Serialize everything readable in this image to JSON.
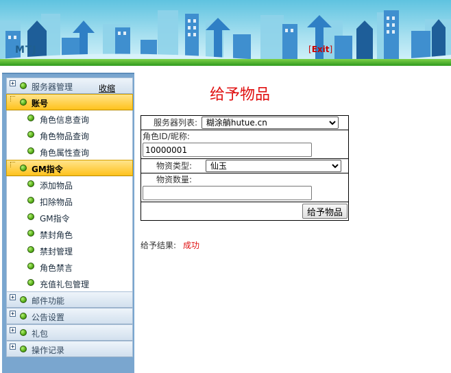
{
  "header": {
    "app_title": "MTJ",
    "exit_open": "[",
    "exit_label": "Exit",
    "exit_close": "]",
    "colors": {
      "sky": "#5fc3e0",
      "grass": "#3aa123",
      "title": "#1f5f8e"
    }
  },
  "sidebar": {
    "groups": [
      {
        "label": "服务器管理",
        "collapse_label": "收缩",
        "expanded": false,
        "icon": "plus-icon"
      },
      {
        "label": "账号",
        "expanded": true,
        "items": [
          "角色信息查询",
          "角色物品查询",
          "角色属性查询"
        ]
      },
      {
        "label": "GM指令",
        "expanded": true,
        "items": [
          "添加物品",
          "扣除物品",
          "GM指令",
          "禁封角色",
          "禁封管理",
          "角色禁言",
          "充值礼包管理"
        ]
      },
      {
        "label": "邮件功能",
        "expanded": false,
        "icon": "plus-icon"
      },
      {
        "label": "公告设置",
        "expanded": false,
        "icon": "plus-icon"
      },
      {
        "label": "礼包",
        "expanded": false,
        "icon": "plus-icon"
      },
      {
        "label": "操作记录",
        "expanded": false,
        "icon": "plus-icon"
      }
    ]
  },
  "main": {
    "title": "给予物品",
    "form": {
      "server_label": "服务器列表:",
      "server_value": "糊涂艄hutue.cn",
      "role_label": "角色ID/昵称:",
      "role_value": "10000001",
      "type_label": "物资类型:",
      "type_value": "仙玉",
      "qty_label": "物资数量:",
      "qty_value": "",
      "submit_label": "给予物品"
    },
    "result": {
      "label": "给予结果:",
      "value": "成功",
      "value_color": "#e01010"
    }
  }
}
